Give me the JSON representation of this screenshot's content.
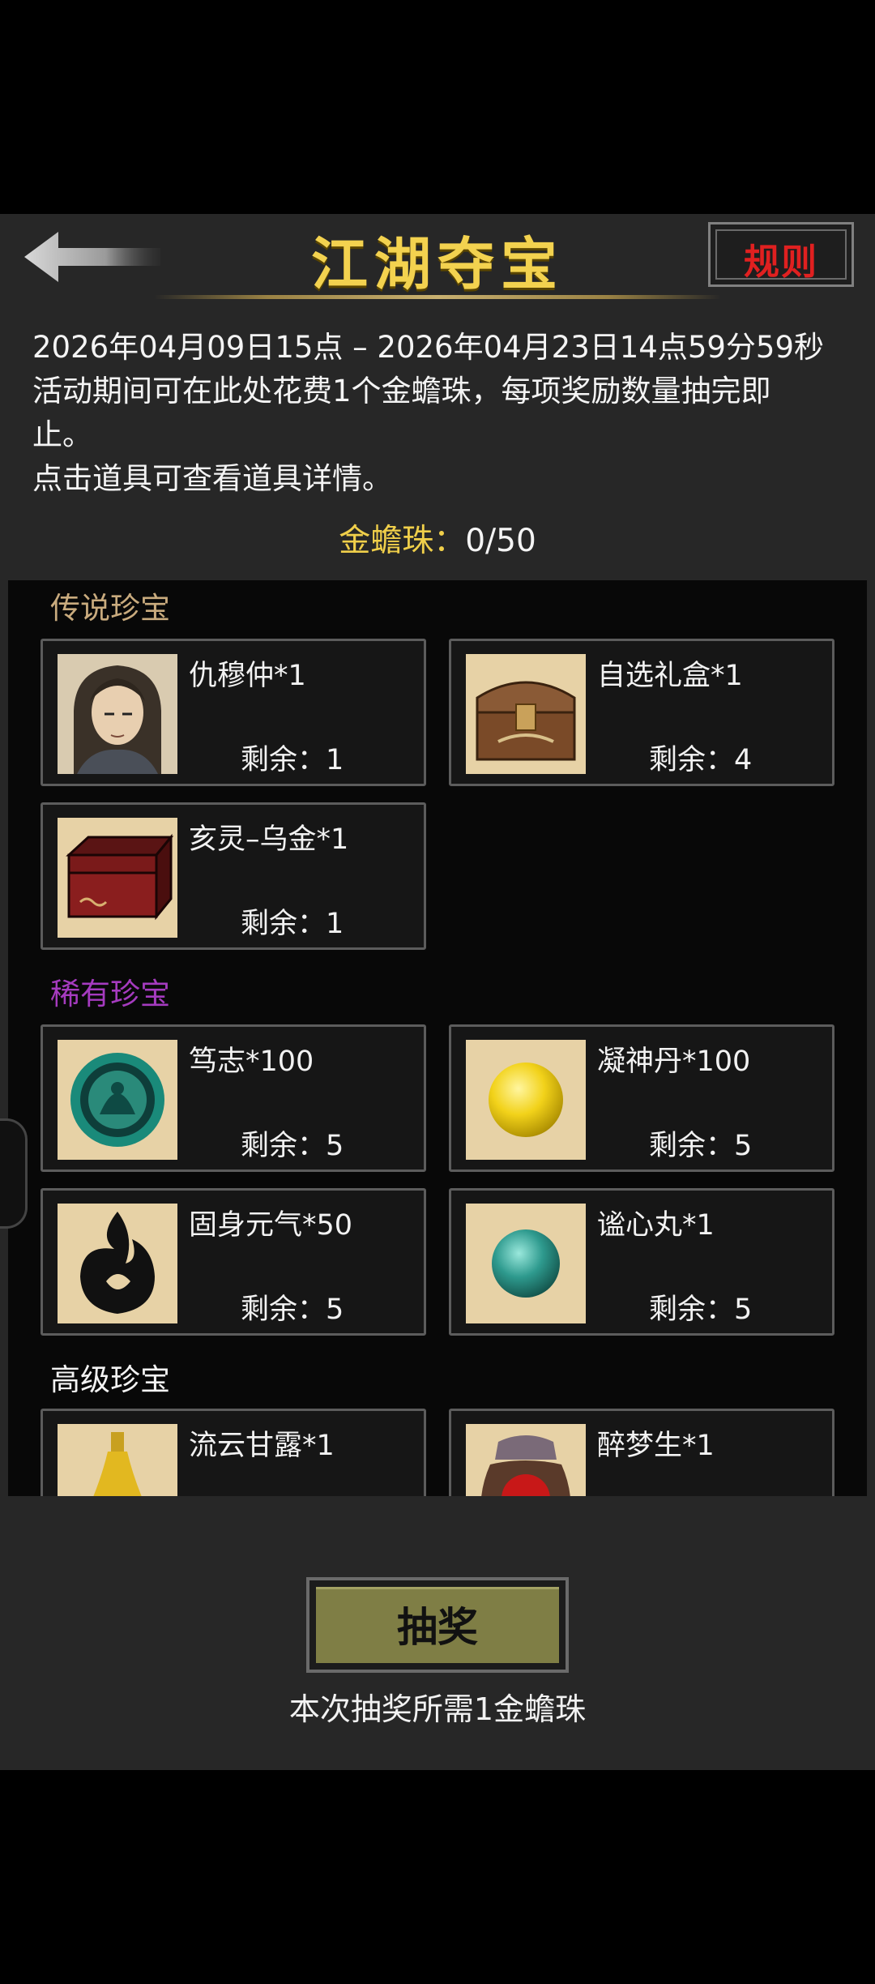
{
  "header": {
    "title": "江湖夺宝",
    "rules_label": "规则"
  },
  "info": {
    "period": "2026年04月09日15点 – 2026年04月23日14点59分59秒",
    "desc_line1": "活动期间可在此处花费1个金蟾珠，每项奖励数量抽完即",
    "desc_line2": "止。",
    "tip": "点击道具可查看道具详情。",
    "currency_label": "金蟾珠：",
    "currency_value": "0/50"
  },
  "sections": [
    {
      "title": "传说珍宝",
      "color": "#c9ab7e",
      "items": [
        {
          "name": "仇穆仲*1",
          "remain": "剩余：1",
          "icon": "portrait-icon"
        },
        {
          "name": "自选礼盒*1",
          "remain": "剩余：4",
          "icon": "treasure-chest-icon"
        },
        {
          "name": "亥灵–乌金*1",
          "remain": "剩余：1",
          "icon": "red-box-icon"
        }
      ]
    },
    {
      "title": "稀有珍宝",
      "color": "#a53bbf",
      "items": [
        {
          "name": "笃志*100",
          "remain": "剩余：5",
          "icon": "jade-orb-icon"
        },
        {
          "name": "凝神丹*100",
          "remain": "剩余：5",
          "icon": "yellow-pill-icon"
        },
        {
          "name": "固身元气*50",
          "remain": "剩余：5",
          "icon": "black-flame-icon"
        },
        {
          "name": "谧心丸*1",
          "remain": "剩余：5",
          "icon": "teal-pill-icon"
        }
      ]
    },
    {
      "title": "高级珍宝",
      "color": "#f2f2f2",
      "items": [
        {
          "name": "流云甘露*1",
          "icon": "gourd-bottle-icon"
        },
        {
          "name": "醉梦生*1",
          "icon": "wine-jar-icon"
        }
      ]
    }
  ],
  "footer": {
    "draw_label": "抽奖",
    "cost_text": "本次抽奖所需1金蟾珠"
  },
  "colors": {
    "title_gold": "#f3d24f",
    "rules_red": "#e02020",
    "button_olive": "#7f7e45"
  }
}
